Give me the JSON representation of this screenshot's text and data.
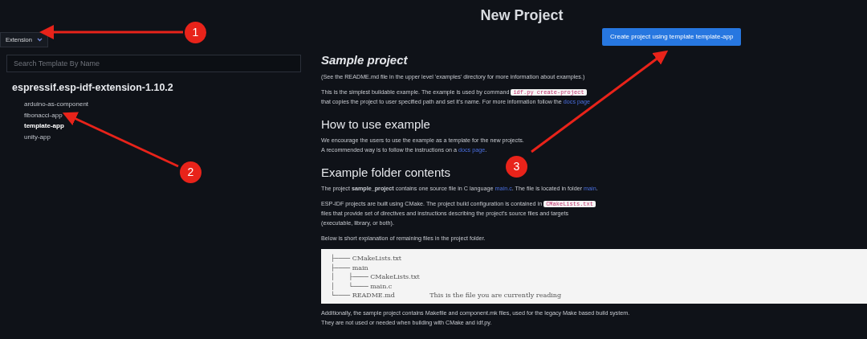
{
  "sidebar": {
    "dropdown": {
      "label": "Extension"
    },
    "search": {
      "placeholder": "Search Template By Name"
    },
    "groups": [
      {
        "title": "espressif.esp-idf-extension-1.10.2",
        "items": [
          {
            "label": "arduino-as-component",
            "selected": false
          },
          {
            "label": "fibonacci-app",
            "selected": false
          },
          {
            "label": "template-app",
            "selected": true
          },
          {
            "label": "unity-app",
            "selected": false
          }
        ]
      }
    ]
  },
  "main": {
    "title": "New Project",
    "create_button": "Create project using template template-app",
    "sections": [
      {
        "heading": "Sample project",
        "paragraphs": [
          {
            "lines": [
              [
                {
                  "kind": "text",
                  "text": "(See the README.md file in the upper level 'examples' directory for more information about examples.)"
                }
              ]
            ]
          },
          {
            "lines": [
              [
                {
                  "kind": "text",
                  "text": "This is the simplest buildable example. The example is used by command "
                },
                {
                  "kind": "code",
                  "text": "idf.py create-project"
                }
              ],
              [
                {
                  "kind": "text",
                  "text": "that copies the project to user specified path and set it's name. For more information follow the "
                },
                {
                  "kind": "link",
                  "text": "docs page"
                }
              ]
            ]
          }
        ]
      },
      {
        "heading": "How to use example",
        "paragraphs": [
          {
            "lines": [
              [
                {
                  "kind": "text",
                  "text": "We encourage the users to use the example as a template for the new projects."
                }
              ],
              [
                {
                  "kind": "text",
                  "text": "A recommended way is to follow the instructions on a "
                },
                {
                  "kind": "link",
                  "text": "docs page"
                },
                {
                  "kind": "text",
                  "text": "."
                }
              ]
            ]
          }
        ]
      },
      {
        "heading": "Example folder contents",
        "paragraphs": [
          {
            "lines": [
              [
                {
                  "kind": "text",
                  "text": "The project "
                },
                {
                  "kind": "bold",
                  "text": "sample_project"
                },
                {
                  "kind": "text",
                  "text": " contains one source file in C language "
                },
                {
                  "kind": "link",
                  "text": "main.c"
                },
                {
                  "kind": "text",
                  "text": ". The file is located in folder "
                },
                {
                  "kind": "link",
                  "text": "main"
                },
                {
                  "kind": "text",
                  "text": "."
                }
              ]
            ]
          },
          {
            "lines": [
              [
                {
                  "kind": "text",
                  "text": "ESP-IDF projects are built using CMake. The project build configuration is contained in "
                },
                {
                  "kind": "code",
                  "text": "CMakeLists.txt"
                }
              ],
              [
                {
                  "kind": "text",
                  "text": "files that provide set of directives and instructions describing the project's source files and targets"
                }
              ],
              [
                {
                  "kind": "text",
                  "text": "(executable, library, or both)."
                }
              ]
            ]
          },
          {
            "lines": [
              [
                {
                  "kind": "text",
                  "text": "Below is short explanation of remaining files in the project folder."
                }
              ]
            ]
          }
        ],
        "code_block": [
          "├──── CMakeLists.txt",
          "├──── main",
          "│       ├──── CMakeLists.txt",
          "│       └──── main.c",
          "└──── README.md                 This is the file you are currently reading"
        ],
        "after": [
          {
            "lines": [
              [
                {
                  "kind": "text",
                  "text": "Additionally, the sample project contains Makefile and component.mk files, used for the legacy Make based build system."
                }
              ],
              [
                {
                  "kind": "text",
                  "text": "They are not used or needed when building with CMake and idf.py."
                }
              ]
            ]
          }
        ]
      }
    ]
  },
  "annotations": [
    {
      "label": "1"
    },
    {
      "label": "2"
    },
    {
      "label": "3"
    }
  ]
}
